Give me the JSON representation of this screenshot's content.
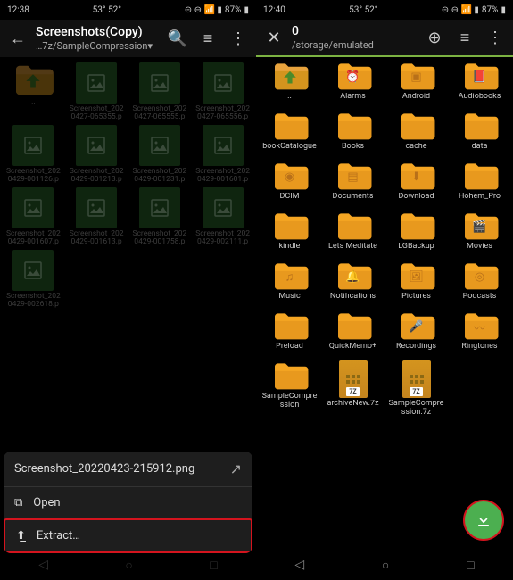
{
  "left": {
    "statusbar": {
      "time": "12:38",
      "temp": "53° 52°",
      "battery": "87%"
    },
    "header": {
      "title": "Screenshots(Copy)",
      "path": "…7z/SampleCompression▾"
    },
    "items": [
      {
        "type": "up",
        "label": ".."
      },
      {
        "type": "img",
        "label": "Screenshot_202 0427-065355.p"
      },
      {
        "type": "img",
        "label": "Screenshot_202 0427-065555.p"
      },
      {
        "type": "img",
        "label": "Screenshot_202 0427-065556.p"
      },
      {
        "type": "img",
        "label": "Screenshot_202 0429-001126.p"
      },
      {
        "type": "img",
        "label": "Screenshot_202 0429-001213.p"
      },
      {
        "type": "img",
        "label": "Screenshot_202 0429-001231.p"
      },
      {
        "type": "img",
        "label": "Screenshot_202 0429-001601.p"
      },
      {
        "type": "img",
        "label": "Screenshot_202 0429-001607.p"
      },
      {
        "type": "img",
        "label": "Screenshot_202 0429-001613.p"
      },
      {
        "type": "img",
        "label": "Screenshot_202 0429-001758.p"
      },
      {
        "type": "img",
        "label": "Screenshot_202 0429-002111.p"
      },
      {
        "type": "img",
        "label": "Screenshot_202 0429-002618.p"
      }
    ],
    "sheet": {
      "filename": "Screenshot_20220423-215912.png",
      "open": "Open",
      "extract": "Extract…"
    }
  },
  "right": {
    "statusbar": {
      "time": "12:40",
      "temp": "53° 52°",
      "battery": "87%"
    },
    "header": {
      "title": "0",
      "path": "/storage/emulated"
    },
    "items": [
      {
        "type": "up",
        "label": ".."
      },
      {
        "type": "folder",
        "icon": "alarm",
        "label": "Alarms"
      },
      {
        "type": "folder",
        "icon": "android",
        "label": "Android"
      },
      {
        "type": "folder",
        "icon": "book",
        "label": "Audiobooks"
      },
      {
        "type": "folder",
        "label": "bookCatalogue"
      },
      {
        "type": "folder",
        "label": "Books"
      },
      {
        "type": "folder",
        "label": "cache"
      },
      {
        "type": "folder",
        "label": "data"
      },
      {
        "type": "folder",
        "icon": "camera",
        "label": "DCIM"
      },
      {
        "type": "folder",
        "icon": "doc",
        "label": "Documents"
      },
      {
        "type": "folder",
        "icon": "down",
        "label": "Download"
      },
      {
        "type": "folder",
        "label": "Hohem_Pro"
      },
      {
        "type": "folder",
        "label": "kindle"
      },
      {
        "type": "folder",
        "label": "Lets Meditate"
      },
      {
        "type": "folder",
        "label": "LGBackup"
      },
      {
        "type": "folder",
        "icon": "movie",
        "label": "Movies"
      },
      {
        "type": "folder",
        "icon": "music",
        "label": "Music"
      },
      {
        "type": "folder",
        "icon": "bell",
        "label": "Notifications"
      },
      {
        "type": "folder",
        "icon": "pic",
        "label": "Pictures"
      },
      {
        "type": "folder",
        "icon": "podcast",
        "label": "Podcasts"
      },
      {
        "type": "folder",
        "label": "Preload"
      },
      {
        "type": "folder",
        "label": "QuickMemo+"
      },
      {
        "type": "folder",
        "icon": "mic",
        "label": "Recordings"
      },
      {
        "type": "folder",
        "icon": "ring",
        "label": "Ringtones"
      },
      {
        "type": "folder",
        "label": "SampleCompression"
      },
      {
        "type": "7z",
        "label": "archiveNew.7z"
      },
      {
        "type": "7z",
        "label": "SampleCompression.7z"
      }
    ]
  },
  "icons": {
    "alarm": "⏰",
    "android": "▣",
    "book": "📕",
    "camera": "◉",
    "doc": "▤",
    "down": "⬇",
    "movie": "🎬",
    "music": "♫",
    "bell": "🔔",
    "pic": "🖼",
    "podcast": "◎",
    "mic": "🎤",
    "ring": "〰"
  }
}
